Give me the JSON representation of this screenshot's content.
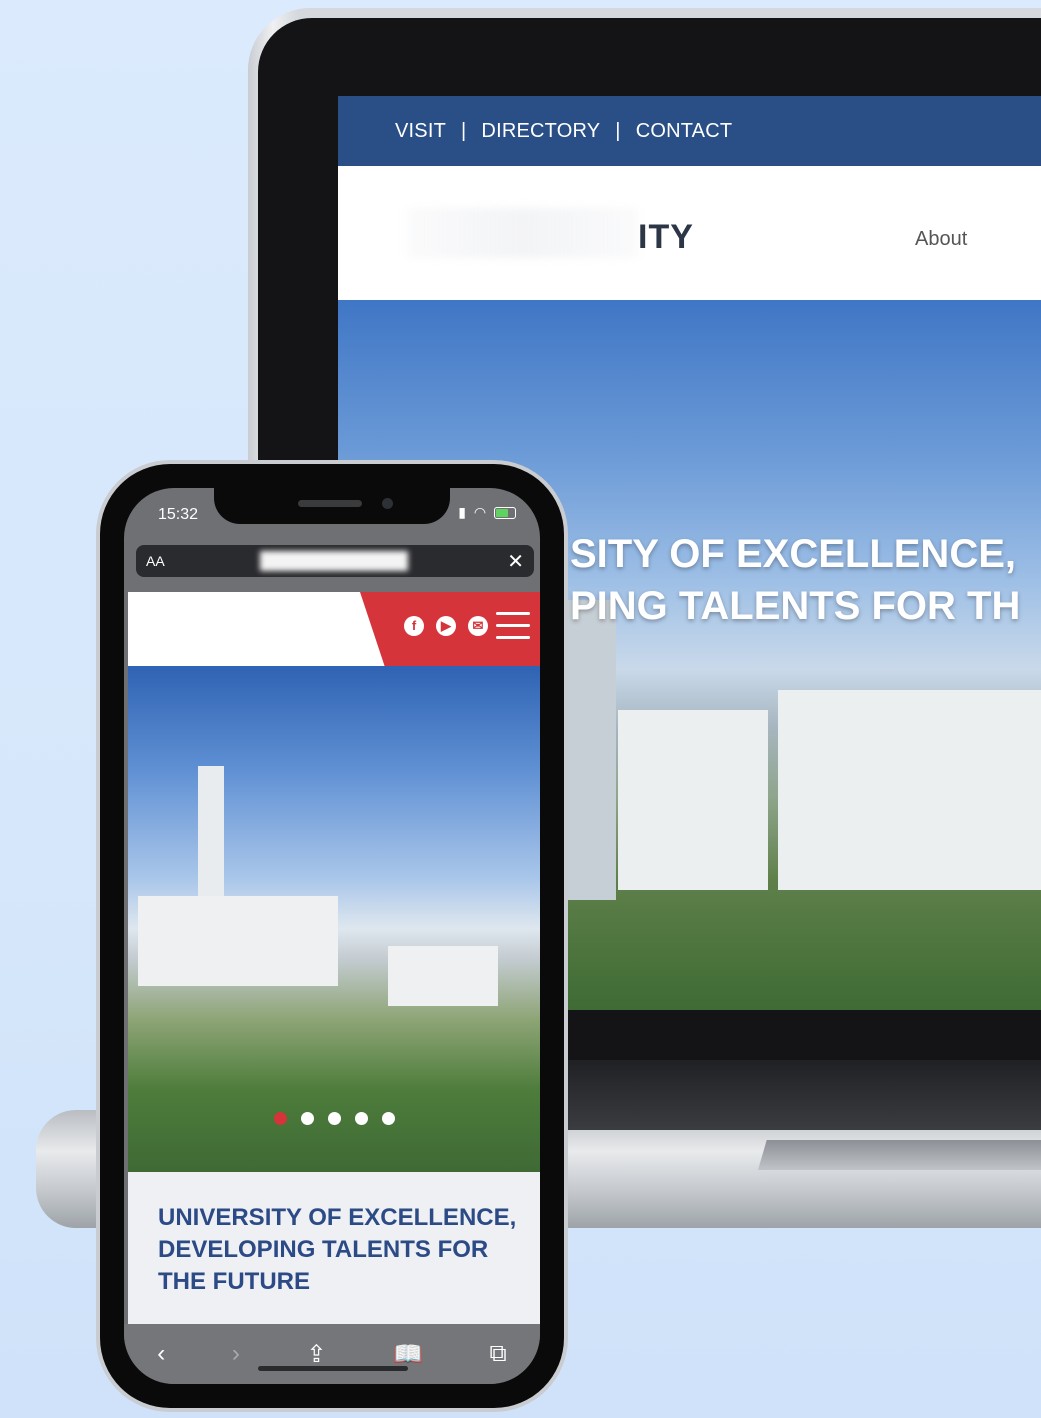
{
  "laptop": {
    "topbar": {
      "visit": "VISIT",
      "directory": "DIRECTORY",
      "contact": "CONTACT",
      "separator": "|"
    },
    "header": {
      "logo_text_partial": "ITY",
      "nav_about": "About"
    },
    "hero": {
      "line1": "SITY OF EXCELLENCE,",
      "line2": "PING TALENTS FOR TH"
    }
  },
  "phone": {
    "status": {
      "time": "15:32"
    },
    "browser": {
      "aa": "AA",
      "close": "✕"
    },
    "header": {
      "social": [
        "f",
        "▶",
        "✉"
      ]
    },
    "hero": {
      "slides": 5,
      "active_slide": 1
    },
    "caption": "UNIVERSITY OF EXCELLENCE, DEVELOPING TALENTS FOR THE FUTURE",
    "toolbar": {
      "back": "‹",
      "forward": "›",
      "share": "⇪",
      "bookmarks": "📖",
      "tabs": "⧉"
    }
  },
  "colors": {
    "brand_blue": "#2a4f86",
    "brand_red": "#d4343a"
  }
}
